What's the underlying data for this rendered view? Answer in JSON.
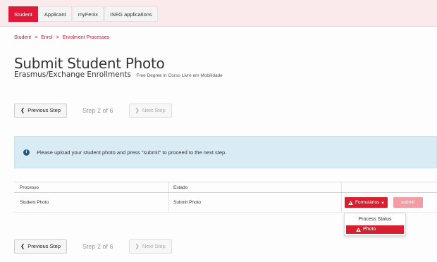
{
  "tabs": [
    {
      "label": "Student",
      "active": true
    },
    {
      "label": "Applicant",
      "active": false
    },
    {
      "label": "myFenix",
      "active": false
    },
    {
      "label": "ISEG applications",
      "active": false
    }
  ],
  "breadcrumb": {
    "items": [
      "Student",
      "Enrol",
      "Enrolment Processes"
    ],
    "separator": ">"
  },
  "page": {
    "title": "Submit Student Photo",
    "subtitle": "Erasmus/Exchange Enrollments",
    "subtitle_small": "Free Degree in Curso Livre em Mobilidade"
  },
  "stepper": {
    "previous_label": "Previous Step",
    "step_label": "Step 2 of 6",
    "next_label": "Next Step"
  },
  "alert": {
    "icon": "info-icon",
    "message": "Please upload your student photo and press \"submit\" to proceed to the next step."
  },
  "table": {
    "headers": [
      "Processo",
      "Estado",
      ""
    ],
    "rows": [
      {
        "processo": "Student Photo",
        "estado": "Submit Photo"
      }
    ]
  },
  "actions": {
    "forms_label": "Formulários",
    "submit_label": "submit"
  },
  "dropdown": {
    "items": [
      "Process Status",
      "Photo"
    ]
  },
  "colors": {
    "brand_red": "#d81f30",
    "topbar_bg": "#fbeaec",
    "alert_bg": "#d9ebf5"
  }
}
